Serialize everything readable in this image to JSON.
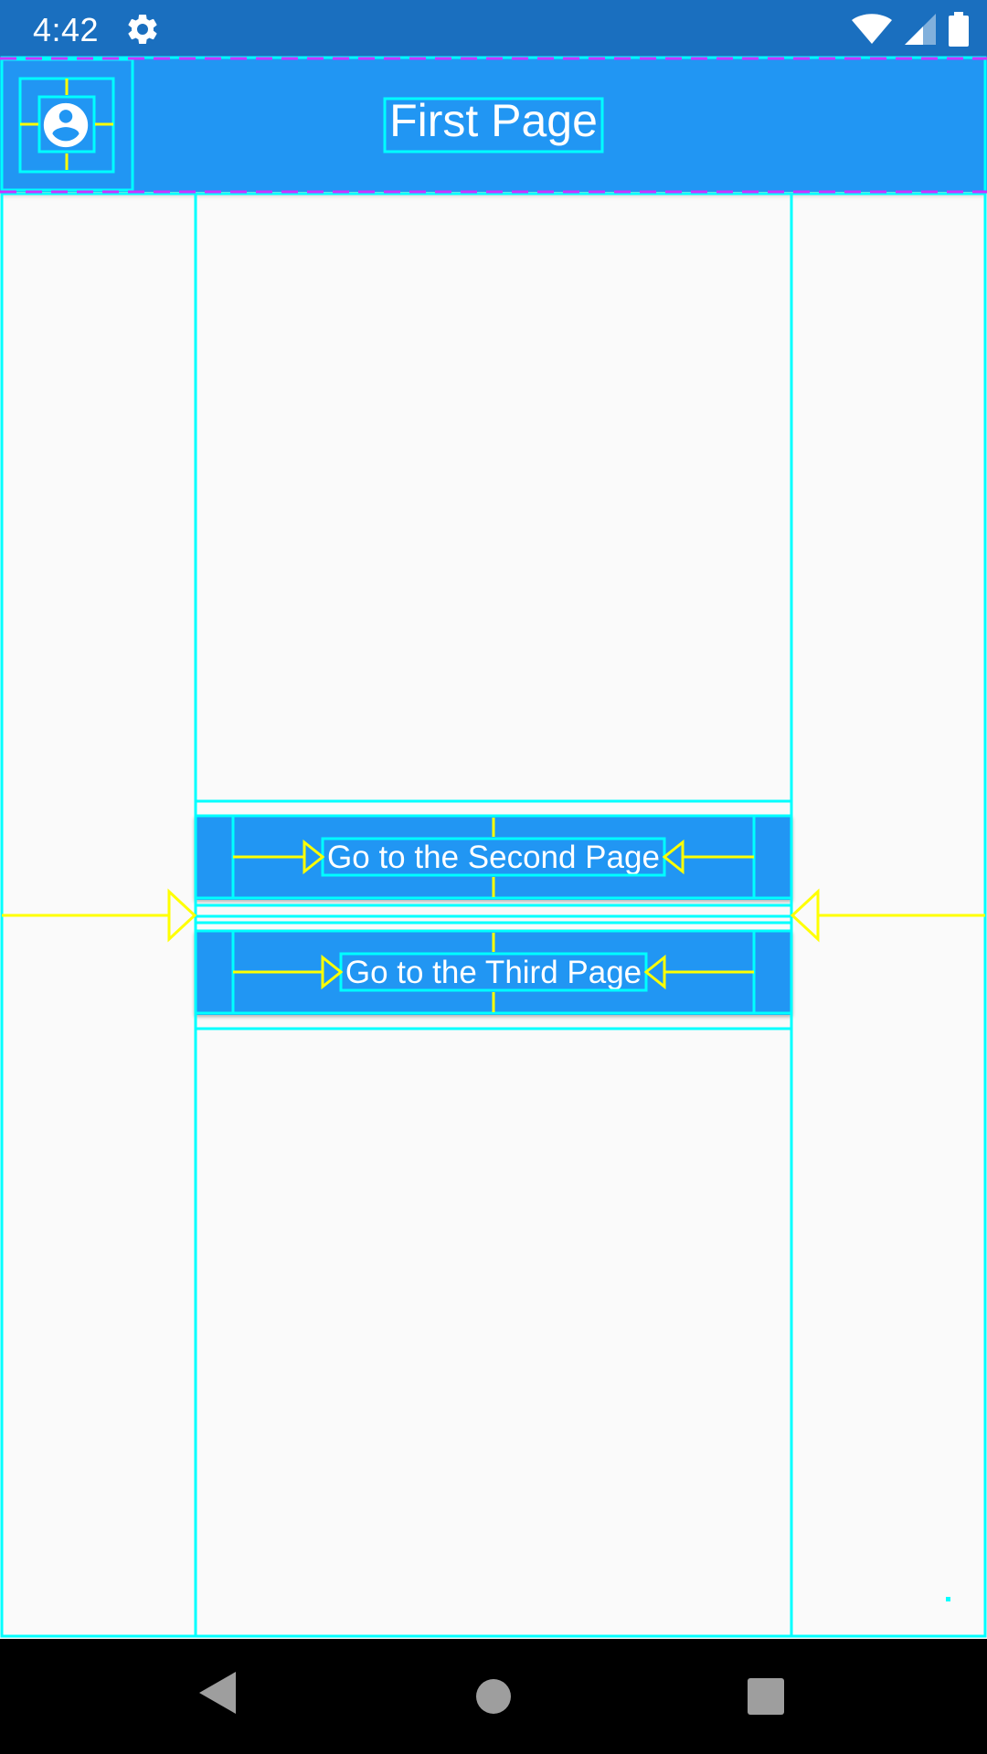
{
  "status_bar": {
    "time": "4:42",
    "icons": [
      "settings-gear-icon",
      "wifi-icon",
      "signal-icon",
      "battery-icon"
    ]
  },
  "app_bar": {
    "title": "First Page",
    "leading_icon": "account-circle-icon",
    "background_color": "#2196f3"
  },
  "buttons": {
    "second_page": "Go to the Second Page",
    "third_page": "Go to the Third Page"
  },
  "nav_bar": {
    "icons": [
      "back-icon",
      "home-icon",
      "recents-icon"
    ]
  },
  "colors": {
    "status_bar": "#1a6fbf",
    "primary": "#2196f3",
    "debug_outline": "#00ffff",
    "debug_arrow": "#ffff00",
    "debug_baseline": "#cc33ff"
  }
}
